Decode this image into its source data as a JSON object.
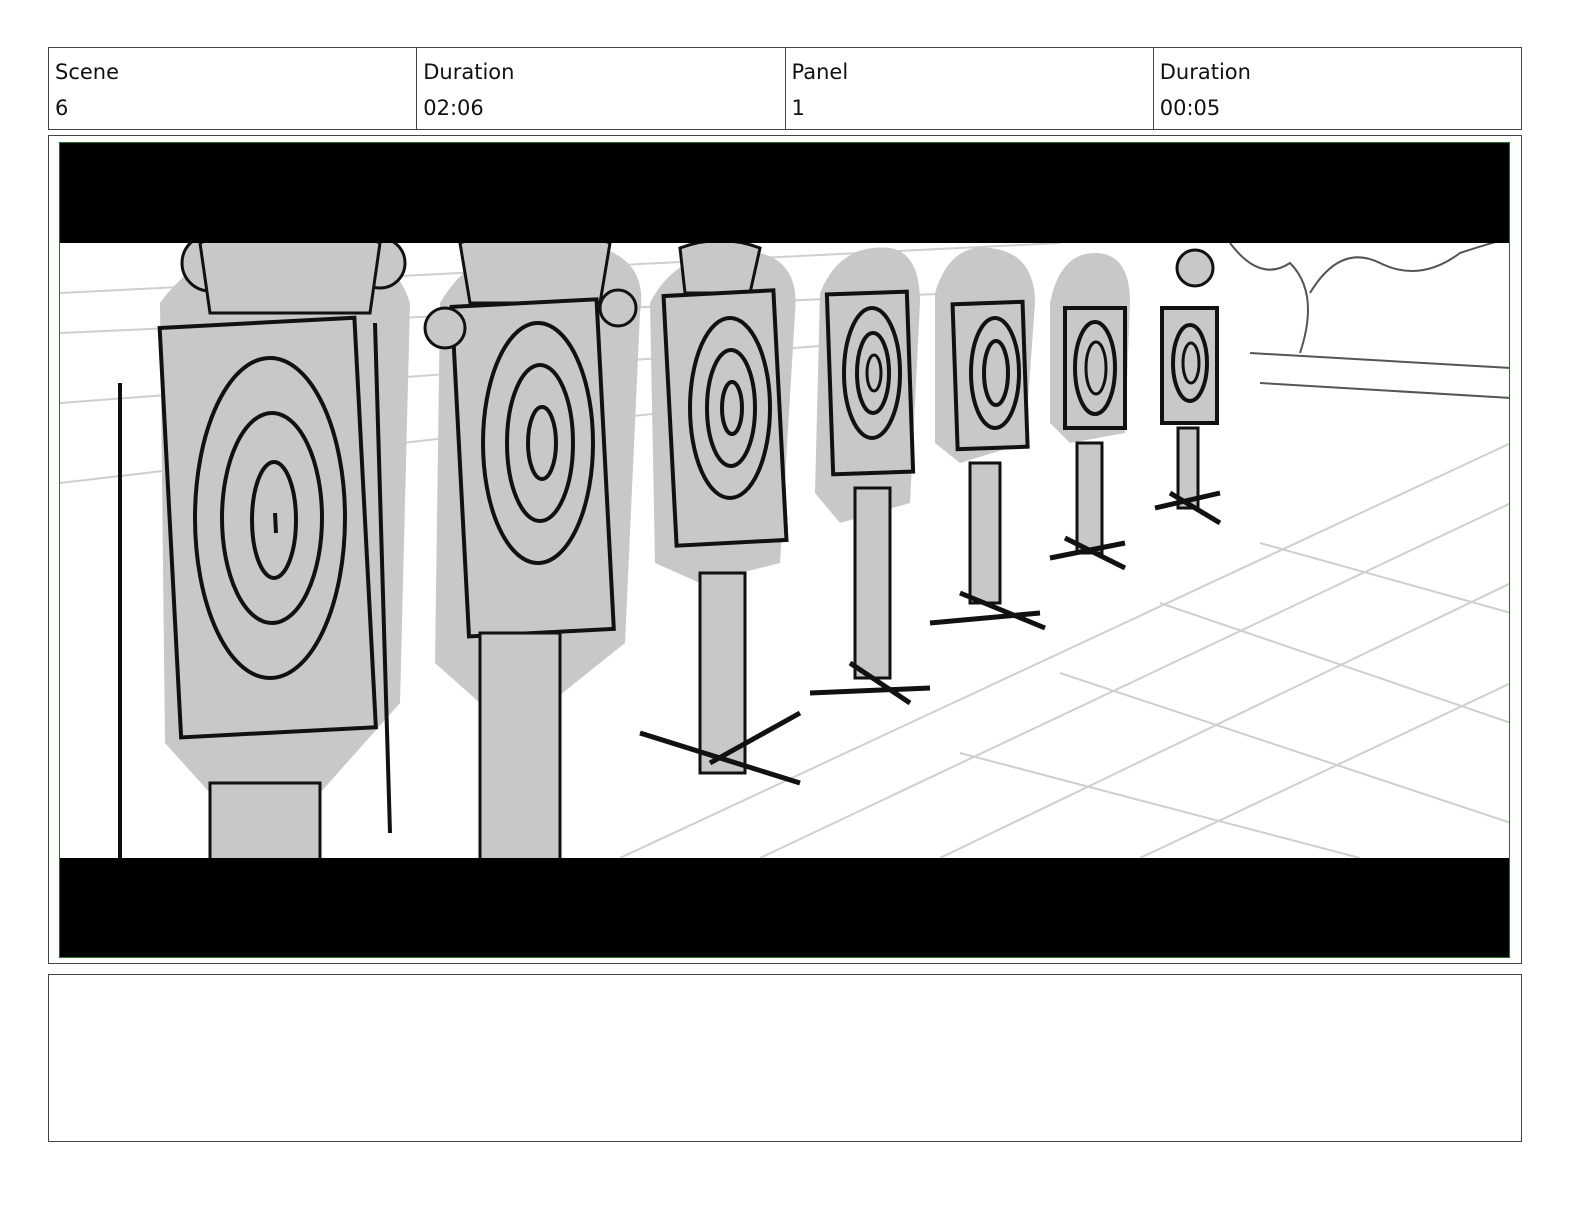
{
  "header": {
    "scene_label": "Scene",
    "scene_value": "6",
    "scene_duration_label": "Duration",
    "scene_duration_value": "02:06",
    "panel_label": "Panel",
    "panel_value": "1",
    "panel_duration_label": "Duration",
    "panel_duration_value": "00:05"
  },
  "panel": {
    "letterbox_color": "#000000",
    "frame_border_color": "#2d6b2d",
    "sketch_fill_color": "#c8c8c8"
  },
  "notes": {
    "text": ""
  }
}
